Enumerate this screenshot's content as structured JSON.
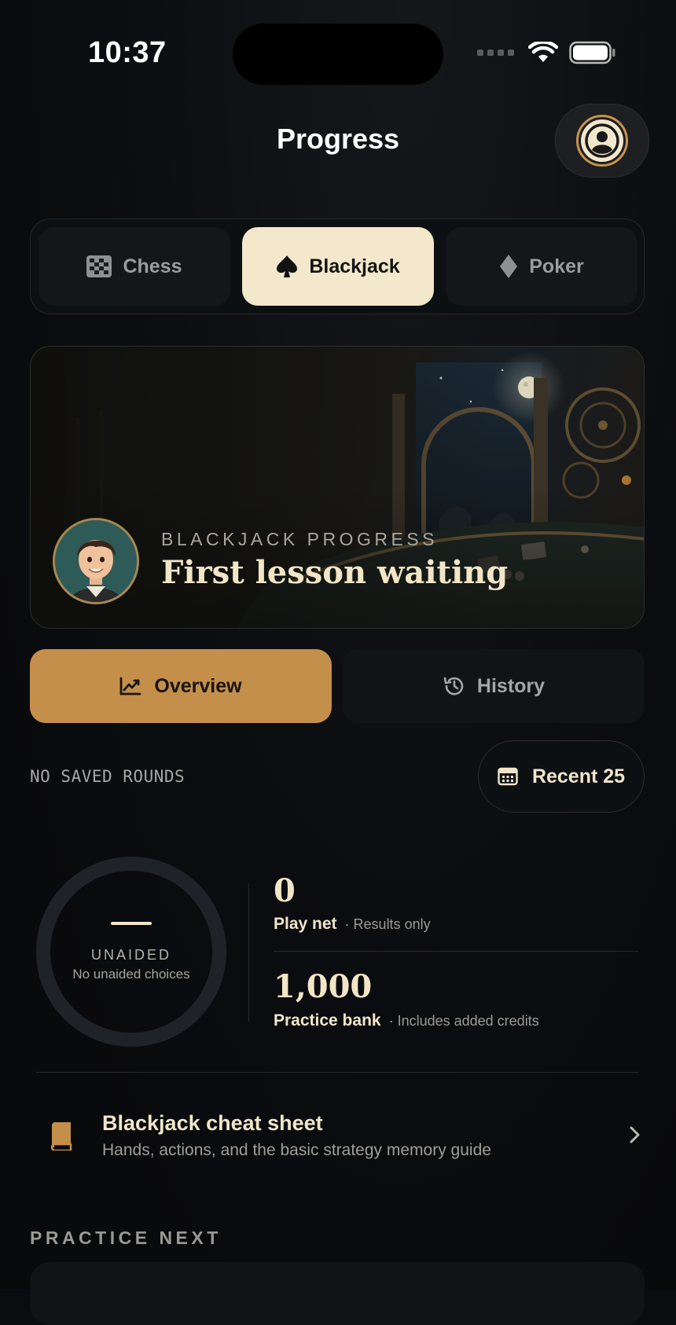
{
  "status_bar": {
    "time": "10:37"
  },
  "header": {
    "title": "Progress"
  },
  "game_tabs": [
    {
      "label": "Chess",
      "icon": "checkerboard-icon",
      "active": false
    },
    {
      "label": "Blackjack",
      "icon": "spade-icon",
      "active": true
    },
    {
      "label": "Poker",
      "icon": "diamond-icon",
      "active": false
    }
  ],
  "hero": {
    "eyebrow": "BLACKJACK PROGRESS",
    "title": "First lesson waiting"
  },
  "view_tabs": [
    {
      "label": "Overview",
      "icon": "chart-line-icon",
      "active": true
    },
    {
      "label": "History",
      "icon": "history-icon",
      "active": false
    }
  ],
  "rounds": {
    "status": "NO SAVED ROUNDS",
    "filter_label": "Recent 25"
  },
  "stats": {
    "ring": {
      "value": "—",
      "label": "UNAIDED",
      "sub": "No unaided choices"
    },
    "play_net": {
      "value": "0",
      "label": "Play net",
      "note": "· Results only"
    },
    "practice_bank": {
      "value": "1,000",
      "label": "Practice bank",
      "note": "· Includes added credits"
    }
  },
  "cheat_sheet": {
    "title": "Blackjack cheat sheet",
    "subtitle": "Hands, actions, and the basic strategy memory guide"
  },
  "practice_next": {
    "heading": "PRACTICE NEXT"
  },
  "colors": {
    "background": "#0b0c0f",
    "accent": "#c48f4a",
    "active_tab": "#f3e8cb",
    "text_cream": "#f2e6c6"
  }
}
